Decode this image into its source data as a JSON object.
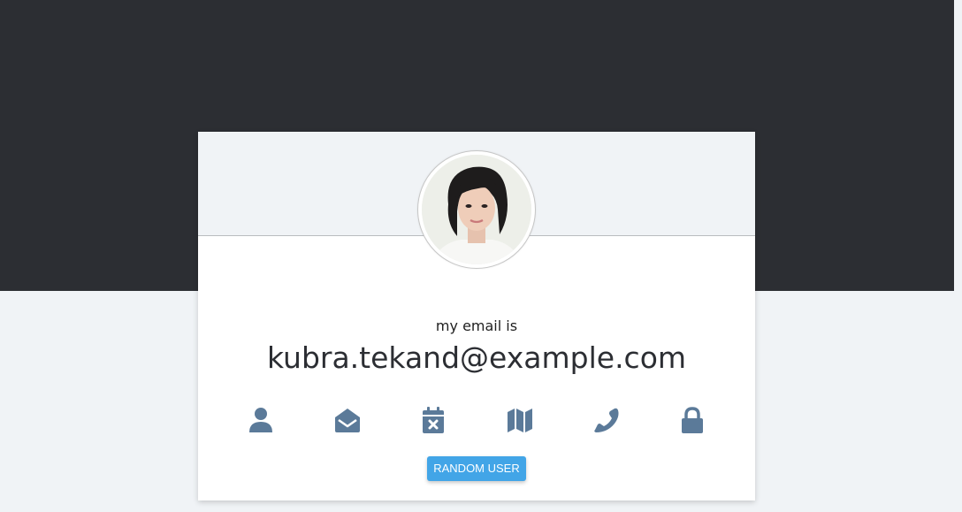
{
  "profile": {
    "label": "my email is",
    "value": "kubra.tekand@example.com"
  },
  "icons": [
    "user-icon",
    "envelope-open-icon",
    "calendar-x-icon",
    "map-icon",
    "phone-icon",
    "lock-icon"
  ],
  "actions": {
    "random_user_label": "RANDOM USER"
  },
  "colors": {
    "top_band": "#2c2e33",
    "page_background": "#f0f3f6",
    "card_background": "#ffffff",
    "icon": "#5b7a99",
    "button": "#42a5e7",
    "value_text": "#2c2e33"
  }
}
